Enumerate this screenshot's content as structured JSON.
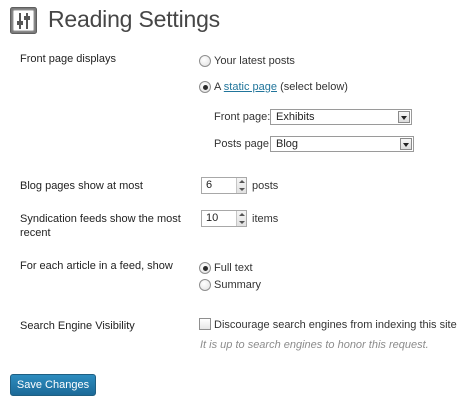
{
  "page": {
    "title": "Reading Settings"
  },
  "front_page": {
    "label": "Front page displays",
    "option_latest": "Your latest posts",
    "option_static_prefix": "A",
    "option_static_link": "static page",
    "option_static_suffix": "(select below)",
    "front_page_label": "Front page:",
    "front_page_value": "Exhibits",
    "posts_page_label": "Posts page:",
    "posts_page_value": "Blog",
    "selected": "static"
  },
  "blog_pages": {
    "label": "Blog pages show at most",
    "value": "6",
    "unit": "posts"
  },
  "syndication": {
    "label_line1": "Syndication feeds show the most",
    "label_line2": "recent",
    "value": "10",
    "unit": "items"
  },
  "feed_article": {
    "label": "For each article in a feed, show",
    "option_full": "Full text",
    "option_summary": "Summary",
    "selected": "full"
  },
  "search_visibility": {
    "label": "Search Engine Visibility",
    "checkbox_label": "Discourage search engines from indexing this site",
    "checked": false,
    "hint": "It is up to search engines to honor this request."
  },
  "actions": {
    "save_label": "Save Changes"
  },
  "colors": {
    "accent": "#21759b",
    "button": "#2584b5"
  }
}
